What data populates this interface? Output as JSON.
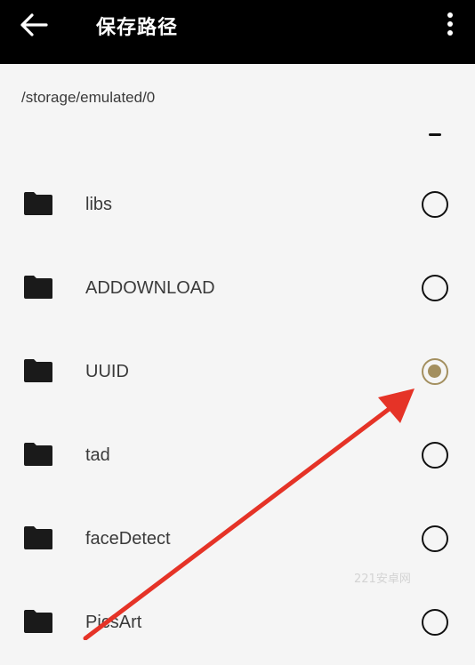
{
  "header": {
    "title": "保存路径",
    "back_icon": "arrow-left-icon",
    "menu_icon": "more-vert-icon"
  },
  "path": "/storage/emulated/0",
  "folders": [
    {
      "name": "libs",
      "selected": false
    },
    {
      "name": "ADDOWNLOAD",
      "selected": false
    },
    {
      "name": "UUID",
      "selected": true
    },
    {
      "name": "tad",
      "selected": false
    },
    {
      "name": "faceDetect",
      "selected": false
    },
    {
      "name": "PicsArt",
      "selected": false
    }
  ],
  "colors": {
    "appbar": "#000000",
    "background": "#f5f5f5",
    "radio_selected": "#a38f5f",
    "annotation_arrow": "#e53327"
  },
  "watermark": "221安卓网"
}
